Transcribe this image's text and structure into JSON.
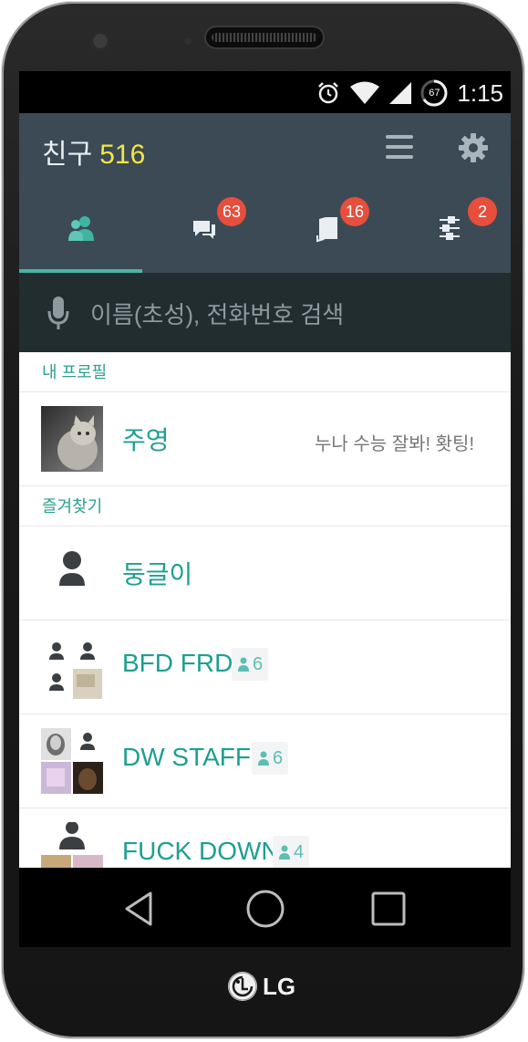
{
  "device": {
    "brand": "LG"
  },
  "status_bar": {
    "time": "1:15",
    "battery": "67",
    "icons": [
      "alarm-icon",
      "wifi-icon",
      "signal-icon",
      "battery-icon"
    ]
  },
  "header": {
    "title": "친구",
    "count": "516"
  },
  "tabs": [
    {
      "name": "friends",
      "icon": "friends-icon",
      "badge": null,
      "active": true
    },
    {
      "name": "chats",
      "icon": "chat-icon",
      "badge": "63"
    },
    {
      "name": "channel",
      "icon": "book-icon",
      "badge": "16"
    },
    {
      "name": "more",
      "icon": "sliders-icon",
      "badge": "2"
    }
  ],
  "search": {
    "placeholder": "이름(초성), 전화번호 검색"
  },
  "sections": {
    "my_profile": "내 프로필",
    "favorites": "즐겨찾기"
  },
  "my_profile": {
    "name": "주영",
    "status_message": "누나 수능 잘봐! 홧팅!"
  },
  "favorites": [
    {
      "name": "둥글이",
      "type": "person"
    },
    {
      "name": "BFD FRD",
      "type": "group",
      "members": "6"
    },
    {
      "name": "DW STAFF",
      "type": "group",
      "members": "6"
    },
    {
      "name": "FUCK DOWN",
      "type": "group",
      "members": "4"
    }
  ],
  "colors": {
    "header_bg": "#3c4a56",
    "accent": "#1c9f91",
    "badge": "#e84e3c",
    "count": "#f5e642",
    "search_bg": "#222d30"
  }
}
